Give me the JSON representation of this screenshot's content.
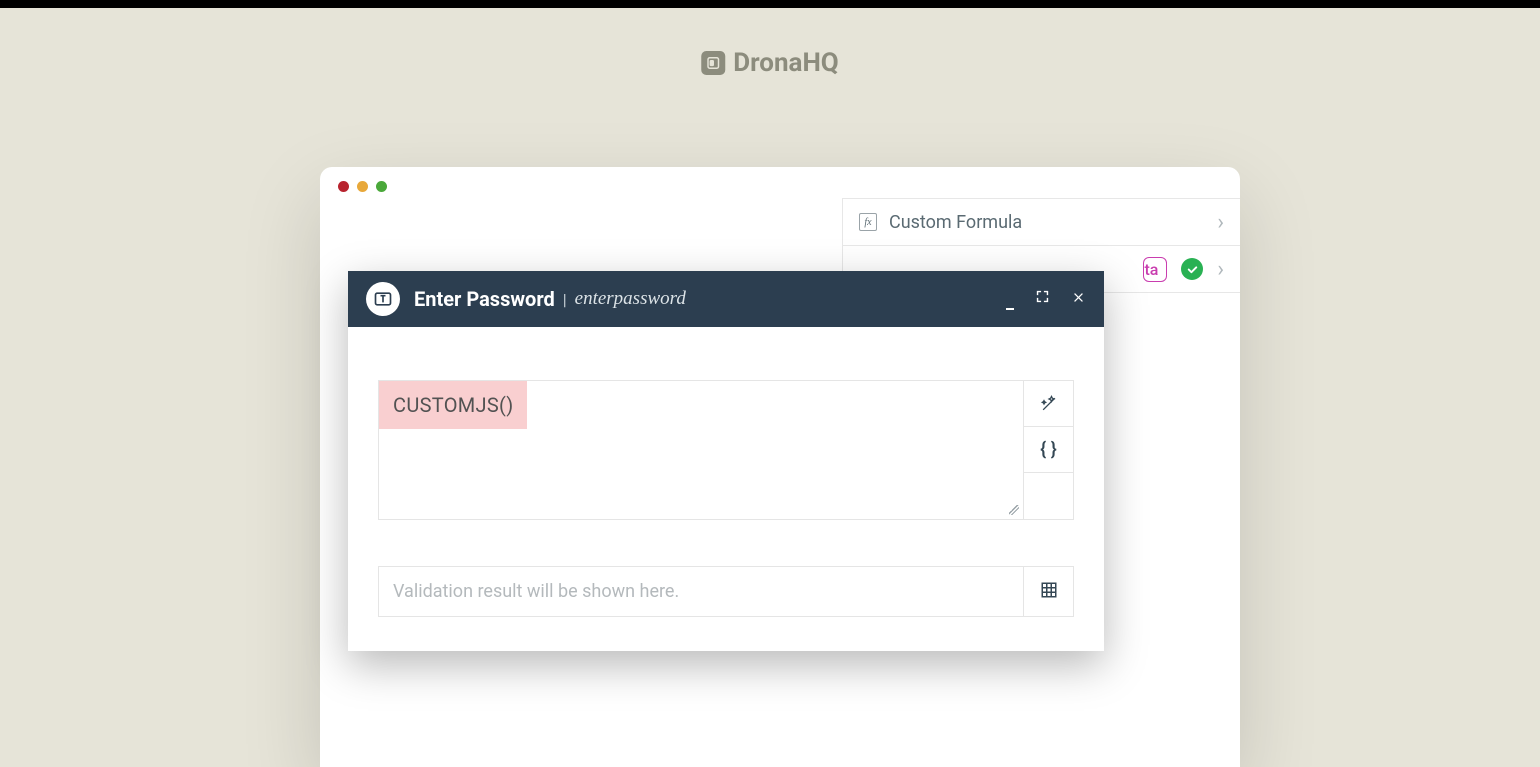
{
  "brand": {
    "name": "DronaHQ"
  },
  "sidepanel": {
    "custom_formula_label": "Custom Formula",
    "badge_text": "ta"
  },
  "modal": {
    "title": "Enter Password",
    "subtitle": "enterpassword",
    "formula_text": "CUSTOMJS()",
    "result_placeholder": "Validation result will be shown here."
  }
}
